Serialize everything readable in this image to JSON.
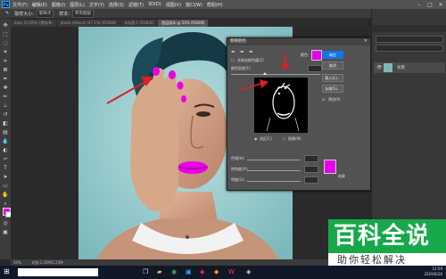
{
  "menubar": {
    "items": [
      "文件(F)",
      "编辑(E)",
      "图像(I)",
      "图层(L)",
      "文字(Y)",
      "选择(S)",
      "滤镜(T)",
      "3D(D)",
      "视图(V)",
      "窗口(W)",
      "帮助(H)"
    ],
    "app_logo": "Ps"
  },
  "options": {
    "sample_label": "取样大小:",
    "sample_value": "取样点",
    "sample_label2": "样本:",
    "sample_value2": "所有图层"
  },
  "tabs": [
    {
      "label": "Easy (2.00%) (蒙版/8)",
      "active": false
    },
    {
      "label": "photo-retouch (47.1%) (RGB/8)",
      "active": false
    },
    {
      "label": "未标题-1 (RGB/8)",
      "active": false
    },
    {
      "label": "图层副本 @ 50% (RGB/8)",
      "active": true
    }
  ],
  "dialog": {
    "title": "替换颜色",
    "localized_label": "本地化颜色簇(Z)",
    "selection_label": "颜色容差(F):",
    "selection_value": "",
    "radio_selection": "选区(C)",
    "radio_image": "图像(M)",
    "hue_label": "色相(H):",
    "sat_label": "饱和度(A):",
    "light_label": "明度(G):",
    "result_label": "结果",
    "color_label": "颜色:",
    "ok": "确定",
    "cancel": "取消",
    "load": "载入(L)...",
    "save": "存储(S)...",
    "preview": "预览(P)",
    "swatch_color": "#e800e8"
  },
  "layers": {
    "layer_name": "背景"
  },
  "status": {
    "zoom": "50%",
    "doc": "文档:2.25M/2.25M"
  },
  "taskbar": {
    "time": "12:59",
    "date": "2019/6/26"
  },
  "watermark": {
    "title": "百科全说",
    "subtitle": "助你轻松解决"
  },
  "colors": {
    "accent": "#1473e6",
    "magenta": "#e800e8",
    "watermark_green": "#17a84a"
  }
}
